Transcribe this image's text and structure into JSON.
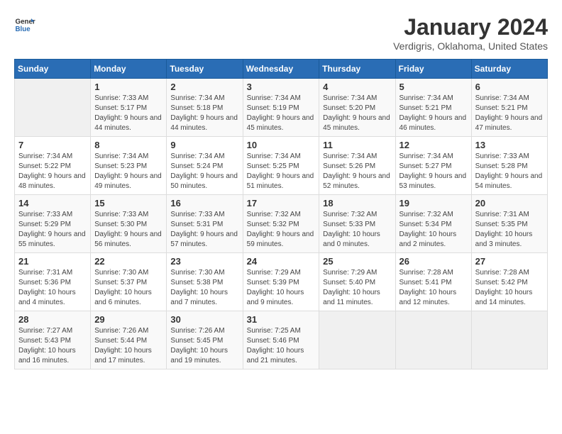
{
  "logo": {
    "line1": "General",
    "line2": "Blue"
  },
  "title": "January 2024",
  "subtitle": "Verdigris, Oklahoma, United States",
  "days_of_week": [
    "Sunday",
    "Monday",
    "Tuesday",
    "Wednesday",
    "Thursday",
    "Friday",
    "Saturday"
  ],
  "weeks": [
    [
      {
        "day": "",
        "sunrise": "",
        "sunset": "",
        "daylight": "",
        "empty": true
      },
      {
        "day": "1",
        "sunrise": "Sunrise: 7:33 AM",
        "sunset": "Sunset: 5:17 PM",
        "daylight": "Daylight: 9 hours and 44 minutes."
      },
      {
        "day": "2",
        "sunrise": "Sunrise: 7:34 AM",
        "sunset": "Sunset: 5:18 PM",
        "daylight": "Daylight: 9 hours and 44 minutes."
      },
      {
        "day": "3",
        "sunrise": "Sunrise: 7:34 AM",
        "sunset": "Sunset: 5:19 PM",
        "daylight": "Daylight: 9 hours and 45 minutes."
      },
      {
        "day": "4",
        "sunrise": "Sunrise: 7:34 AM",
        "sunset": "Sunset: 5:20 PM",
        "daylight": "Daylight: 9 hours and 45 minutes."
      },
      {
        "day": "5",
        "sunrise": "Sunrise: 7:34 AM",
        "sunset": "Sunset: 5:21 PM",
        "daylight": "Daylight: 9 hours and 46 minutes."
      },
      {
        "day": "6",
        "sunrise": "Sunrise: 7:34 AM",
        "sunset": "Sunset: 5:21 PM",
        "daylight": "Daylight: 9 hours and 47 minutes."
      }
    ],
    [
      {
        "day": "7",
        "sunrise": "Sunrise: 7:34 AM",
        "sunset": "Sunset: 5:22 PM",
        "daylight": "Daylight: 9 hours and 48 minutes."
      },
      {
        "day": "8",
        "sunrise": "Sunrise: 7:34 AM",
        "sunset": "Sunset: 5:23 PM",
        "daylight": "Daylight: 9 hours and 49 minutes."
      },
      {
        "day": "9",
        "sunrise": "Sunrise: 7:34 AM",
        "sunset": "Sunset: 5:24 PM",
        "daylight": "Daylight: 9 hours and 50 minutes."
      },
      {
        "day": "10",
        "sunrise": "Sunrise: 7:34 AM",
        "sunset": "Sunset: 5:25 PM",
        "daylight": "Daylight: 9 hours and 51 minutes."
      },
      {
        "day": "11",
        "sunrise": "Sunrise: 7:34 AM",
        "sunset": "Sunset: 5:26 PM",
        "daylight": "Daylight: 9 hours and 52 minutes."
      },
      {
        "day": "12",
        "sunrise": "Sunrise: 7:34 AM",
        "sunset": "Sunset: 5:27 PM",
        "daylight": "Daylight: 9 hours and 53 minutes."
      },
      {
        "day": "13",
        "sunrise": "Sunrise: 7:33 AM",
        "sunset": "Sunset: 5:28 PM",
        "daylight": "Daylight: 9 hours and 54 minutes."
      }
    ],
    [
      {
        "day": "14",
        "sunrise": "Sunrise: 7:33 AM",
        "sunset": "Sunset: 5:29 PM",
        "daylight": "Daylight: 9 hours and 55 minutes."
      },
      {
        "day": "15",
        "sunrise": "Sunrise: 7:33 AM",
        "sunset": "Sunset: 5:30 PM",
        "daylight": "Daylight: 9 hours and 56 minutes."
      },
      {
        "day": "16",
        "sunrise": "Sunrise: 7:33 AM",
        "sunset": "Sunset: 5:31 PM",
        "daylight": "Daylight: 9 hours and 57 minutes."
      },
      {
        "day": "17",
        "sunrise": "Sunrise: 7:32 AM",
        "sunset": "Sunset: 5:32 PM",
        "daylight": "Daylight: 9 hours and 59 minutes."
      },
      {
        "day": "18",
        "sunrise": "Sunrise: 7:32 AM",
        "sunset": "Sunset: 5:33 PM",
        "daylight": "Daylight: 10 hours and 0 minutes."
      },
      {
        "day": "19",
        "sunrise": "Sunrise: 7:32 AM",
        "sunset": "Sunset: 5:34 PM",
        "daylight": "Daylight: 10 hours and 2 minutes."
      },
      {
        "day": "20",
        "sunrise": "Sunrise: 7:31 AM",
        "sunset": "Sunset: 5:35 PM",
        "daylight": "Daylight: 10 hours and 3 minutes."
      }
    ],
    [
      {
        "day": "21",
        "sunrise": "Sunrise: 7:31 AM",
        "sunset": "Sunset: 5:36 PM",
        "daylight": "Daylight: 10 hours and 4 minutes."
      },
      {
        "day": "22",
        "sunrise": "Sunrise: 7:30 AM",
        "sunset": "Sunset: 5:37 PM",
        "daylight": "Daylight: 10 hours and 6 minutes."
      },
      {
        "day": "23",
        "sunrise": "Sunrise: 7:30 AM",
        "sunset": "Sunset: 5:38 PM",
        "daylight": "Daylight: 10 hours and 7 minutes."
      },
      {
        "day": "24",
        "sunrise": "Sunrise: 7:29 AM",
        "sunset": "Sunset: 5:39 PM",
        "daylight": "Daylight: 10 hours and 9 minutes."
      },
      {
        "day": "25",
        "sunrise": "Sunrise: 7:29 AM",
        "sunset": "Sunset: 5:40 PM",
        "daylight": "Daylight: 10 hours and 11 minutes."
      },
      {
        "day": "26",
        "sunrise": "Sunrise: 7:28 AM",
        "sunset": "Sunset: 5:41 PM",
        "daylight": "Daylight: 10 hours and 12 minutes."
      },
      {
        "day": "27",
        "sunrise": "Sunrise: 7:28 AM",
        "sunset": "Sunset: 5:42 PM",
        "daylight": "Daylight: 10 hours and 14 minutes."
      }
    ],
    [
      {
        "day": "28",
        "sunrise": "Sunrise: 7:27 AM",
        "sunset": "Sunset: 5:43 PM",
        "daylight": "Daylight: 10 hours and 16 minutes."
      },
      {
        "day": "29",
        "sunrise": "Sunrise: 7:26 AM",
        "sunset": "Sunset: 5:44 PM",
        "daylight": "Daylight: 10 hours and 17 minutes."
      },
      {
        "day": "30",
        "sunrise": "Sunrise: 7:26 AM",
        "sunset": "Sunset: 5:45 PM",
        "daylight": "Daylight: 10 hours and 19 minutes."
      },
      {
        "day": "31",
        "sunrise": "Sunrise: 7:25 AM",
        "sunset": "Sunset: 5:46 PM",
        "daylight": "Daylight: 10 hours and 21 minutes."
      },
      {
        "day": "",
        "sunrise": "",
        "sunset": "",
        "daylight": "",
        "empty": true
      },
      {
        "day": "",
        "sunrise": "",
        "sunset": "",
        "daylight": "",
        "empty": true
      },
      {
        "day": "",
        "sunrise": "",
        "sunset": "",
        "daylight": "",
        "empty": true
      }
    ]
  ]
}
